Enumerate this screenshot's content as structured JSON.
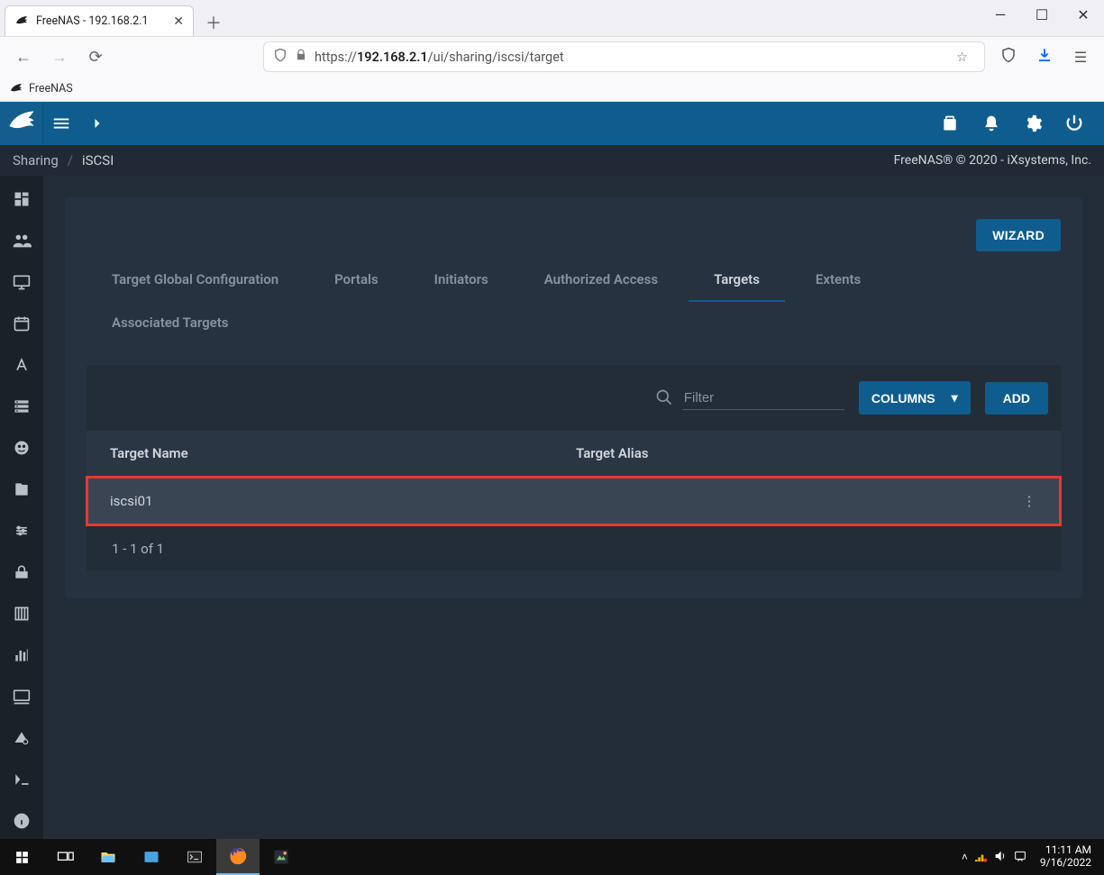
{
  "browser": {
    "tab_title": "FreeNAS - 192.168.2.1",
    "url_prefix": "https://",
    "url_host": "192.168.2.1",
    "url_path": "/ui/sharing/iscsi/target",
    "bookmark": "FreeNAS"
  },
  "app": {
    "breadcrumb": {
      "root": "Sharing",
      "current": "iSCSI"
    },
    "footer_text": "FreeNAS® © 2020 - iXsystems, Inc.",
    "wizard_btn": "WIZARD",
    "tabs": {
      "global": "Target Global Configuration",
      "portals": "Portals",
      "initiators": "Initiators",
      "auth": "Authorized Access",
      "targets": "Targets",
      "extents": "Extents",
      "assoc": "Associated Targets"
    },
    "toolbar": {
      "filter_placeholder": "Filter",
      "columns_label": "COLUMNS",
      "add_label": "ADD"
    },
    "table": {
      "col_name": "Target Name",
      "col_alias": "Target Alias",
      "rows": [
        {
          "name": "iscsi01",
          "alias": ""
        }
      ],
      "pager": "1 - 1 of 1"
    }
  },
  "tray": {
    "time": "11:11 AM",
    "date": "9/16/2022"
  }
}
